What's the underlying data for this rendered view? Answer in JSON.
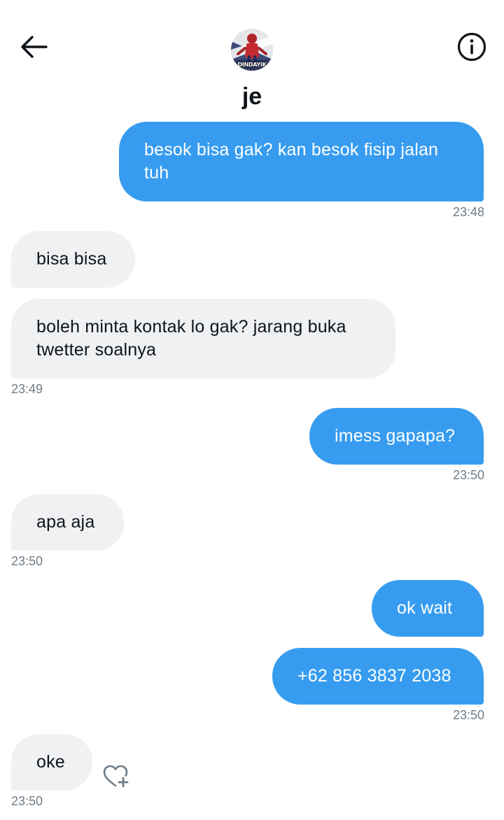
{
  "header": {
    "title": "je",
    "avatar_caption": "DINDAYIK",
    "back_icon": "arrow-left-icon",
    "info_icon": "info-icon"
  },
  "messages": [
    {
      "direction": "out",
      "text": "besok bisa gak? kan besok fisip jalan tuh",
      "time": "23:48"
    },
    {
      "direction": "in",
      "text": "bisa bisa",
      "time": ""
    },
    {
      "direction": "in",
      "text": "boleh minta kontak lo gak? jarang buka twetter soalnya",
      "time": "23:49"
    },
    {
      "direction": "out",
      "text": "imess gapapa?",
      "time": "23:50"
    },
    {
      "direction": "in",
      "text": "apa aja",
      "time": "23:50"
    },
    {
      "direction": "out",
      "text": "ok wait",
      "time": ""
    },
    {
      "direction": "out",
      "text": "+62 856 3837 2038",
      "time": "23:50"
    },
    {
      "direction": "in",
      "text": "oke",
      "time": "23:50"
    }
  ],
  "colors": {
    "outgoing_bubble": "#379cf0",
    "incoming_bubble": "#eff1f3",
    "timestamp": "#6f7b85",
    "text": "#0f1419"
  },
  "reaction": {
    "icon": "heart-plus-icon"
  }
}
